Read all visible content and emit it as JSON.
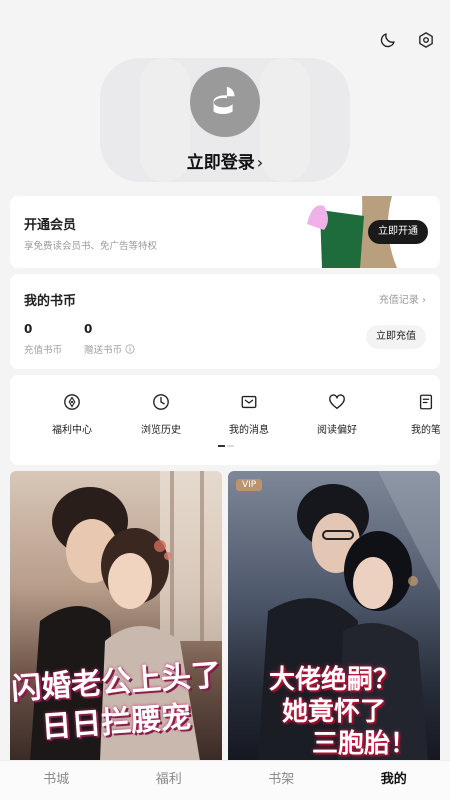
{
  "header": {
    "icons": [
      "moon-icon",
      "settings-icon"
    ]
  },
  "profile": {
    "login_label": "立即登录"
  },
  "vip": {
    "title": "开通会员",
    "subtitle": "享免费读会员书、免广告等特权",
    "button": "立即开通"
  },
  "wallet": {
    "title": "我的书币",
    "records_link": "充值记录",
    "recharge_coins": {
      "value": "0",
      "label": "充值书币"
    },
    "gift_coins": {
      "value": "0",
      "label": "赠送书币"
    },
    "recharge_button": "立即充值"
  },
  "menu": {
    "items": [
      {
        "label": "福利中心",
        "icon": "compass-icon"
      },
      {
        "label": "浏览历史",
        "icon": "clock-icon"
      },
      {
        "label": "我的消息",
        "icon": "mail-icon"
      },
      {
        "label": "阅读偏好",
        "icon": "heart-icon"
      },
      {
        "label": "我的笔",
        "icon": "notebook-icon"
      }
    ]
  },
  "books": [
    {
      "title_line1": "闪婚老公上头了",
      "title_line2": "日日拦腰宠",
      "vip": ""
    },
    {
      "title_line1": "大佬绝嗣？",
      "title_line2": "她竟怀了",
      "title_line3": "三胞胎！",
      "vip": "VIP"
    }
  ],
  "tabs": [
    {
      "label": "书城",
      "active": false
    },
    {
      "label": "福利",
      "active": false
    },
    {
      "label": "书架",
      "active": false
    },
    {
      "label": "我的",
      "active": true
    }
  ],
  "colors": {
    "background": "#f4f4f5",
    "card": "#ffffff",
    "button_dark": "#1a1a1a",
    "vip_tag": "#b89470"
  }
}
